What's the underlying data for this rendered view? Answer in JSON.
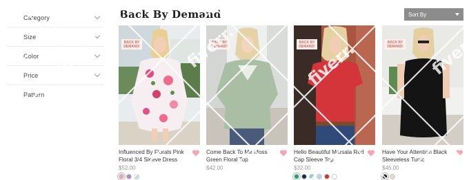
{
  "filters": [
    {
      "label": "Category",
      "has_chevron": true
    },
    {
      "label": "Size",
      "has_chevron": true
    },
    {
      "label": "Color",
      "has_chevron": true
    },
    {
      "label": "Price",
      "has_chevron": true
    },
    {
      "label": "Pattern",
      "has_chevron": false
    }
  ],
  "page_title": "Back By Demand",
  "sort": {
    "label": "Sort By"
  },
  "badge_text": "BACK BY DEMAND!",
  "products": [
    {
      "name": "Influenced By Florals Pink Floral 3/4 Sleeve Dress",
      "price": "$52.00",
      "swatches": [
        "#e5a4bd",
        "#a98bcb",
        "#bfe3e0"
      ]
    },
    {
      "name": "Come Back To Me Moss Green Floral Top",
      "price": "$42.00",
      "swatches": []
    },
    {
      "name": "Hello Beautiful Marsala Red Cap Sleeve Top",
      "price": "$32.00",
      "swatches": [
        "#1ea37d",
        "#1d2a57",
        "#8fd3c8",
        "#b8d5ee",
        "#c0392b",
        "#ffffff"
      ]
    },
    {
      "name": "Have Your Attention Black Sleeveless Tunic",
      "price": "$46.00",
      "swatches": [
        "#111111",
        "#e9d8c8"
      ]
    }
  ],
  "colors": {
    "heart": "#f2a8b5",
    "badge_text": "#e2675a",
    "sort_bg": "#8c8c8c"
  },
  "watermark_text": "fiverr."
}
